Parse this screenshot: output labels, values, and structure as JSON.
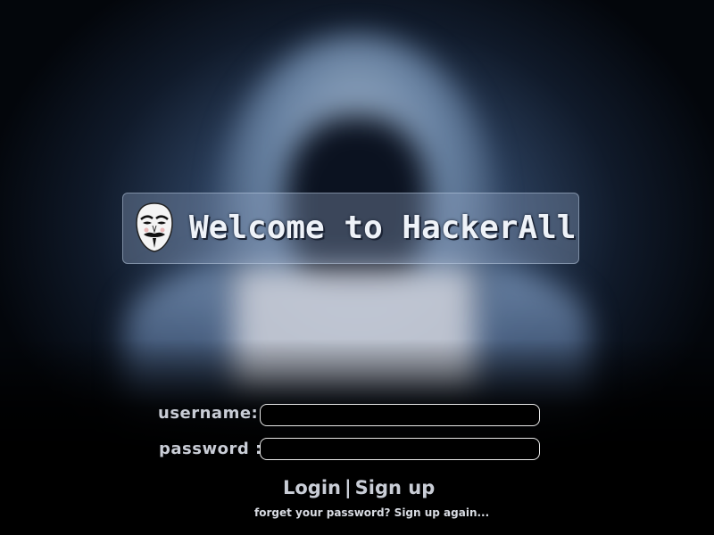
{
  "banner": {
    "title": "Welcome to HackerAll",
    "icon": "anonymous-mask-icon"
  },
  "form": {
    "username_label": "username:",
    "username_value": "",
    "password_label": "password :",
    "password_value": "",
    "login_label": "Login",
    "separator": "|",
    "signup_label": "Sign up",
    "forgot_text": "forget your password? Sign up again..."
  },
  "colors": {
    "background": "#000000",
    "label_text": "#c9cdd6",
    "input_border": "#e8e8e8",
    "banner_text": "#eef2f8"
  }
}
